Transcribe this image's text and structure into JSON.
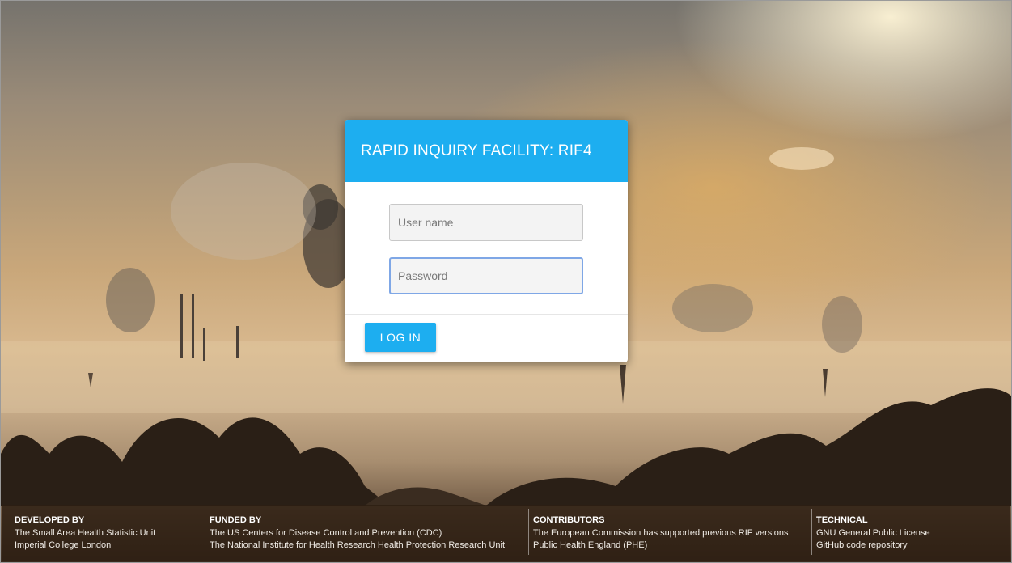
{
  "app": {
    "title": "RAPID INQUIRY FACILITY: RIF4"
  },
  "login": {
    "username_placeholder": "User name",
    "username_value": "",
    "password_placeholder": "Password",
    "password_value": "",
    "button_label": "LOG IN"
  },
  "footer": {
    "columns": [
      {
        "title": "DEVELOPED BY",
        "lines": [
          "The Small Area Health Statistic Unit",
          "Imperial College London"
        ]
      },
      {
        "title": "FUNDED BY",
        "lines": [
          "The US Centers for Disease Control and Prevention (CDC)",
          "The National Institute for Health Research Health Protection Research Unit"
        ]
      },
      {
        "title": "CONTRIBUTORS",
        "lines": [
          "The European Commission has supported previous RIF versions",
          "Public Health England (PHE)"
        ]
      },
      {
        "title": "TECHNICAL",
        "lines": [
          "GNU General Public License",
          "GitHub code repository"
        ]
      }
    ]
  },
  "colors": {
    "accent": "#1daef0",
    "card_background": "#ffffff",
    "footer_background": "#2d1e12"
  },
  "background": {
    "icon": "industrial-landscape-sunset-image"
  }
}
